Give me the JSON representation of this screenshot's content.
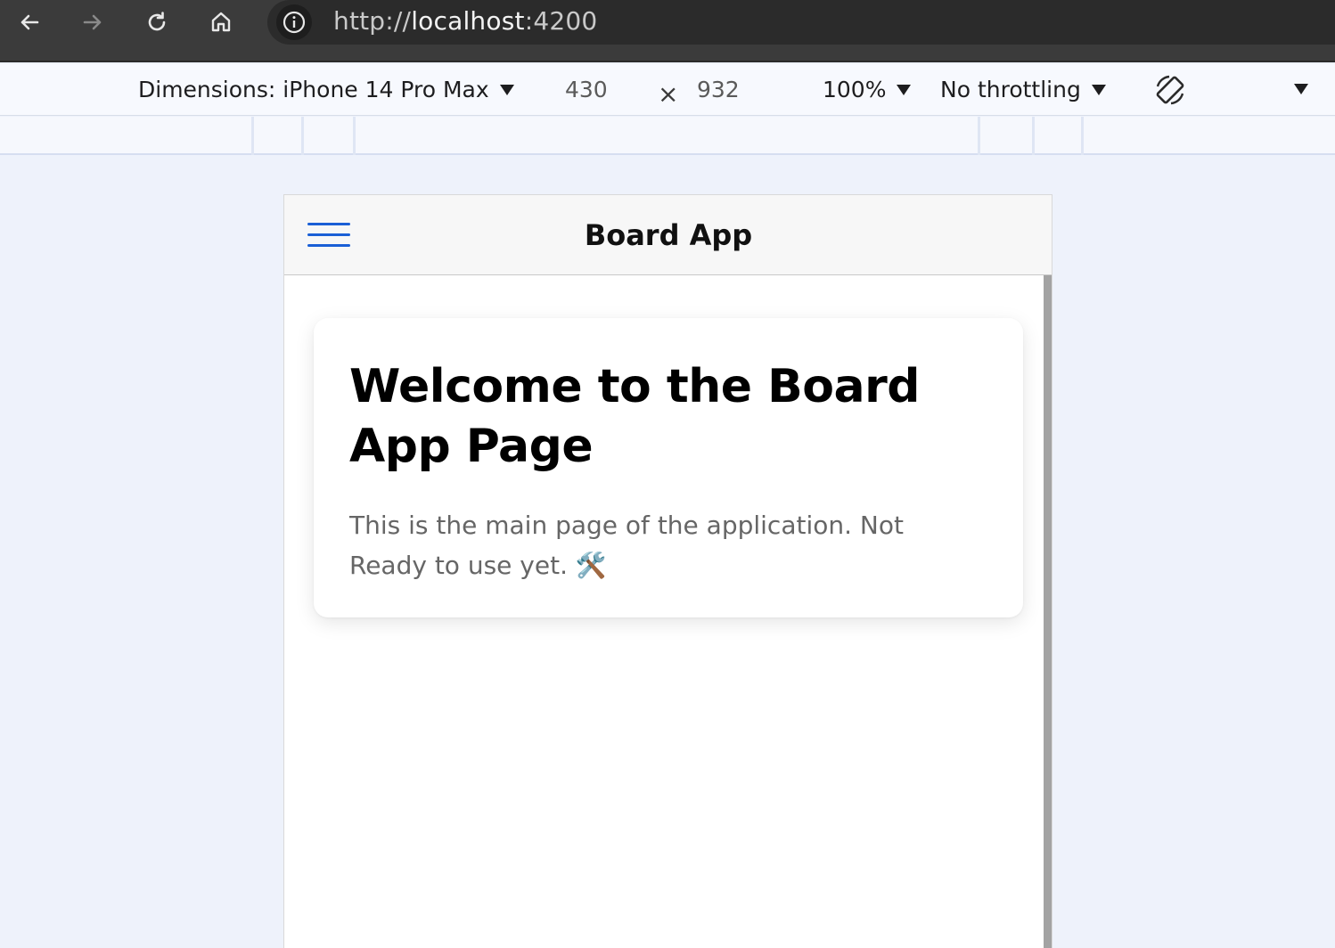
{
  "browser": {
    "url_scheme": "http://",
    "url_host": "localhost",
    "url_port": ":4200",
    "icons": [
      "back-arrow-icon",
      "forward-arrow-icon",
      "reload-icon",
      "home-icon",
      "info-icon"
    ]
  },
  "device_toolbar": {
    "dimensions_label": "Dimensions: iPhone 14 Pro Max",
    "width": "430",
    "times": "×",
    "height": "932",
    "zoom": "100%",
    "throttling": "No throttling"
  },
  "app": {
    "title": "Board App",
    "card_title": "Welcome to the Board App Page",
    "card_text": "This is the main page of the application. Not Ready to use yet. 🛠️"
  },
  "colors": {
    "browser_bar": "#3b3b3b",
    "toolbar_bg": "#f7f9fe",
    "page_bg": "#eef2fb",
    "hamburger": "#1a5fd6",
    "card_text": "#666666"
  }
}
